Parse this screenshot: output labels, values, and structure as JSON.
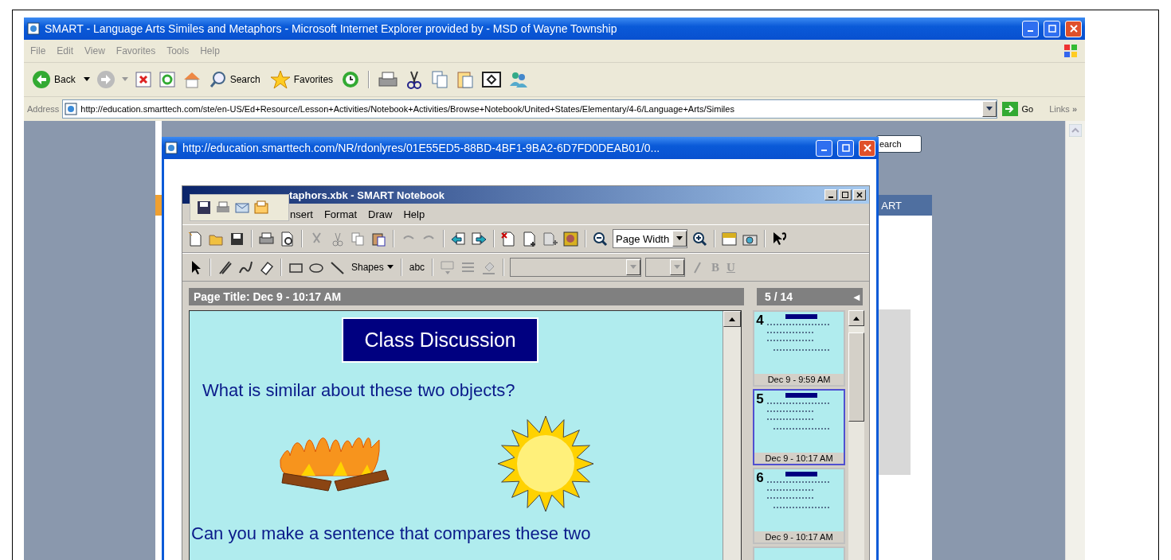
{
  "browser": {
    "title": "SMART - Language Arts Similes and Metaphors - Microsoft Internet Explorer provided by  - MSD of Wayne Township",
    "menu": [
      "File",
      "Edit",
      "View",
      "Favorites",
      "Tools",
      "Help"
    ],
    "toolbar": {
      "back": "Back",
      "search": "Search",
      "favorites": "Favorites"
    },
    "address": {
      "label": "Address",
      "value": "http://education.smarttech.com/ste/en-US/Ed+Resource/Lesson+Activities/Notebook+Activities/Browse+Notebook/United+States/Elementary/4-6/Language+Arts/Similes",
      "go": "Go",
      "links": "Links",
      "links_chevron": "»"
    }
  },
  "page": {
    "search_button": "earch",
    "banner": "ART"
  },
  "popup": {
    "title": "http://education.smarttech.com/NR/rdonlyres/01E55ED5-88BD-4BF1-9BA2-6D7FD0DEAB01/0..."
  },
  "notebook": {
    "title": "taphors.xbk - SMART Notebook",
    "menu": [
      "nsert",
      "Format",
      "Draw",
      "Help"
    ],
    "zoom": "Page Width",
    "shapes": "Shapes",
    "text_tool": "abc",
    "bold": "B",
    "underline": "U",
    "page_title": "Page Title: Dec 9 - 10:17 AM",
    "counter": "5 / 14",
    "counter_arrow": "◂",
    "slide": {
      "heading": "Class Discussion",
      "question": "What is similar about these two objects?",
      "prompt": "Can you make a sentence that compares these two"
    },
    "thumbnails": [
      {
        "number": "4",
        "date": "Dec 9 - 9:59 AM",
        "selected": false
      },
      {
        "number": "5",
        "date": "Dec 9 - 10:17 AM",
        "selected": true
      },
      {
        "number": "6",
        "date": "Dec 9 - 10:17 AM",
        "selected": false
      }
    ]
  }
}
